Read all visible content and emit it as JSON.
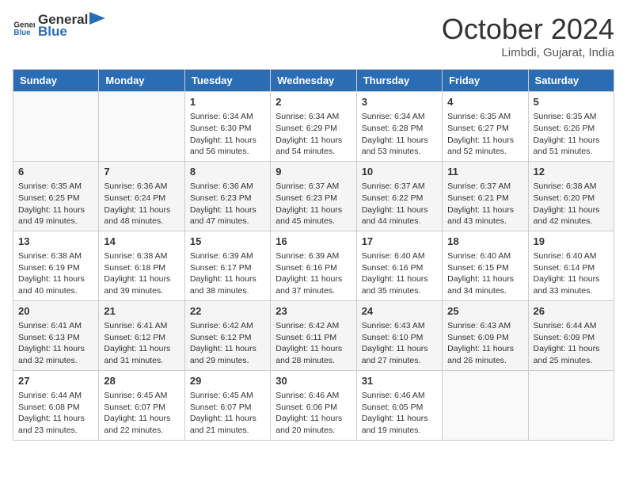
{
  "header": {
    "logo_general": "General",
    "logo_blue": "Blue",
    "title": "October 2024",
    "location": "Limbdi, Gujarat, India"
  },
  "days_of_week": [
    "Sunday",
    "Monday",
    "Tuesday",
    "Wednesday",
    "Thursday",
    "Friday",
    "Saturday"
  ],
  "weeks": [
    [
      {
        "day": "",
        "sunrise": "",
        "sunset": "",
        "daylight": ""
      },
      {
        "day": "",
        "sunrise": "",
        "sunset": "",
        "daylight": ""
      },
      {
        "day": "1",
        "sunrise": "Sunrise: 6:34 AM",
        "sunset": "Sunset: 6:30 PM",
        "daylight": "Daylight: 11 hours and 56 minutes."
      },
      {
        "day": "2",
        "sunrise": "Sunrise: 6:34 AM",
        "sunset": "Sunset: 6:29 PM",
        "daylight": "Daylight: 11 hours and 54 minutes."
      },
      {
        "day": "3",
        "sunrise": "Sunrise: 6:34 AM",
        "sunset": "Sunset: 6:28 PM",
        "daylight": "Daylight: 11 hours and 53 minutes."
      },
      {
        "day": "4",
        "sunrise": "Sunrise: 6:35 AM",
        "sunset": "Sunset: 6:27 PM",
        "daylight": "Daylight: 11 hours and 52 minutes."
      },
      {
        "day": "5",
        "sunrise": "Sunrise: 6:35 AM",
        "sunset": "Sunset: 6:26 PM",
        "daylight": "Daylight: 11 hours and 51 minutes."
      }
    ],
    [
      {
        "day": "6",
        "sunrise": "Sunrise: 6:35 AM",
        "sunset": "Sunset: 6:25 PM",
        "daylight": "Daylight: 11 hours and 49 minutes."
      },
      {
        "day": "7",
        "sunrise": "Sunrise: 6:36 AM",
        "sunset": "Sunset: 6:24 PM",
        "daylight": "Daylight: 11 hours and 48 minutes."
      },
      {
        "day": "8",
        "sunrise": "Sunrise: 6:36 AM",
        "sunset": "Sunset: 6:23 PM",
        "daylight": "Daylight: 11 hours and 47 minutes."
      },
      {
        "day": "9",
        "sunrise": "Sunrise: 6:37 AM",
        "sunset": "Sunset: 6:23 PM",
        "daylight": "Daylight: 11 hours and 45 minutes."
      },
      {
        "day": "10",
        "sunrise": "Sunrise: 6:37 AM",
        "sunset": "Sunset: 6:22 PM",
        "daylight": "Daylight: 11 hours and 44 minutes."
      },
      {
        "day": "11",
        "sunrise": "Sunrise: 6:37 AM",
        "sunset": "Sunset: 6:21 PM",
        "daylight": "Daylight: 11 hours and 43 minutes."
      },
      {
        "day": "12",
        "sunrise": "Sunrise: 6:38 AM",
        "sunset": "Sunset: 6:20 PM",
        "daylight": "Daylight: 11 hours and 42 minutes."
      }
    ],
    [
      {
        "day": "13",
        "sunrise": "Sunrise: 6:38 AM",
        "sunset": "Sunset: 6:19 PM",
        "daylight": "Daylight: 11 hours and 40 minutes."
      },
      {
        "day": "14",
        "sunrise": "Sunrise: 6:38 AM",
        "sunset": "Sunset: 6:18 PM",
        "daylight": "Daylight: 11 hours and 39 minutes."
      },
      {
        "day": "15",
        "sunrise": "Sunrise: 6:39 AM",
        "sunset": "Sunset: 6:17 PM",
        "daylight": "Daylight: 11 hours and 38 minutes."
      },
      {
        "day": "16",
        "sunrise": "Sunrise: 6:39 AM",
        "sunset": "Sunset: 6:16 PM",
        "daylight": "Daylight: 11 hours and 37 minutes."
      },
      {
        "day": "17",
        "sunrise": "Sunrise: 6:40 AM",
        "sunset": "Sunset: 6:16 PM",
        "daylight": "Daylight: 11 hours and 35 minutes."
      },
      {
        "day": "18",
        "sunrise": "Sunrise: 6:40 AM",
        "sunset": "Sunset: 6:15 PM",
        "daylight": "Daylight: 11 hours and 34 minutes."
      },
      {
        "day": "19",
        "sunrise": "Sunrise: 6:40 AM",
        "sunset": "Sunset: 6:14 PM",
        "daylight": "Daylight: 11 hours and 33 minutes."
      }
    ],
    [
      {
        "day": "20",
        "sunrise": "Sunrise: 6:41 AM",
        "sunset": "Sunset: 6:13 PM",
        "daylight": "Daylight: 11 hours and 32 minutes."
      },
      {
        "day": "21",
        "sunrise": "Sunrise: 6:41 AM",
        "sunset": "Sunset: 6:12 PM",
        "daylight": "Daylight: 11 hours and 31 minutes."
      },
      {
        "day": "22",
        "sunrise": "Sunrise: 6:42 AM",
        "sunset": "Sunset: 6:12 PM",
        "daylight": "Daylight: 11 hours and 29 minutes."
      },
      {
        "day": "23",
        "sunrise": "Sunrise: 6:42 AM",
        "sunset": "Sunset: 6:11 PM",
        "daylight": "Daylight: 11 hours and 28 minutes."
      },
      {
        "day": "24",
        "sunrise": "Sunrise: 6:43 AM",
        "sunset": "Sunset: 6:10 PM",
        "daylight": "Daylight: 11 hours and 27 minutes."
      },
      {
        "day": "25",
        "sunrise": "Sunrise: 6:43 AM",
        "sunset": "Sunset: 6:09 PM",
        "daylight": "Daylight: 11 hours and 26 minutes."
      },
      {
        "day": "26",
        "sunrise": "Sunrise: 6:44 AM",
        "sunset": "Sunset: 6:09 PM",
        "daylight": "Daylight: 11 hours and 25 minutes."
      }
    ],
    [
      {
        "day": "27",
        "sunrise": "Sunrise: 6:44 AM",
        "sunset": "Sunset: 6:08 PM",
        "daylight": "Daylight: 11 hours and 23 minutes."
      },
      {
        "day": "28",
        "sunrise": "Sunrise: 6:45 AM",
        "sunset": "Sunset: 6:07 PM",
        "daylight": "Daylight: 11 hours and 22 minutes."
      },
      {
        "day": "29",
        "sunrise": "Sunrise: 6:45 AM",
        "sunset": "Sunset: 6:07 PM",
        "daylight": "Daylight: 11 hours and 21 minutes."
      },
      {
        "day": "30",
        "sunrise": "Sunrise: 6:46 AM",
        "sunset": "Sunset: 6:06 PM",
        "daylight": "Daylight: 11 hours and 20 minutes."
      },
      {
        "day": "31",
        "sunrise": "Sunrise: 6:46 AM",
        "sunset": "Sunset: 6:05 PM",
        "daylight": "Daylight: 11 hours and 19 minutes."
      },
      {
        "day": "",
        "sunrise": "",
        "sunset": "",
        "daylight": ""
      },
      {
        "day": "",
        "sunrise": "",
        "sunset": "",
        "daylight": ""
      }
    ]
  ]
}
